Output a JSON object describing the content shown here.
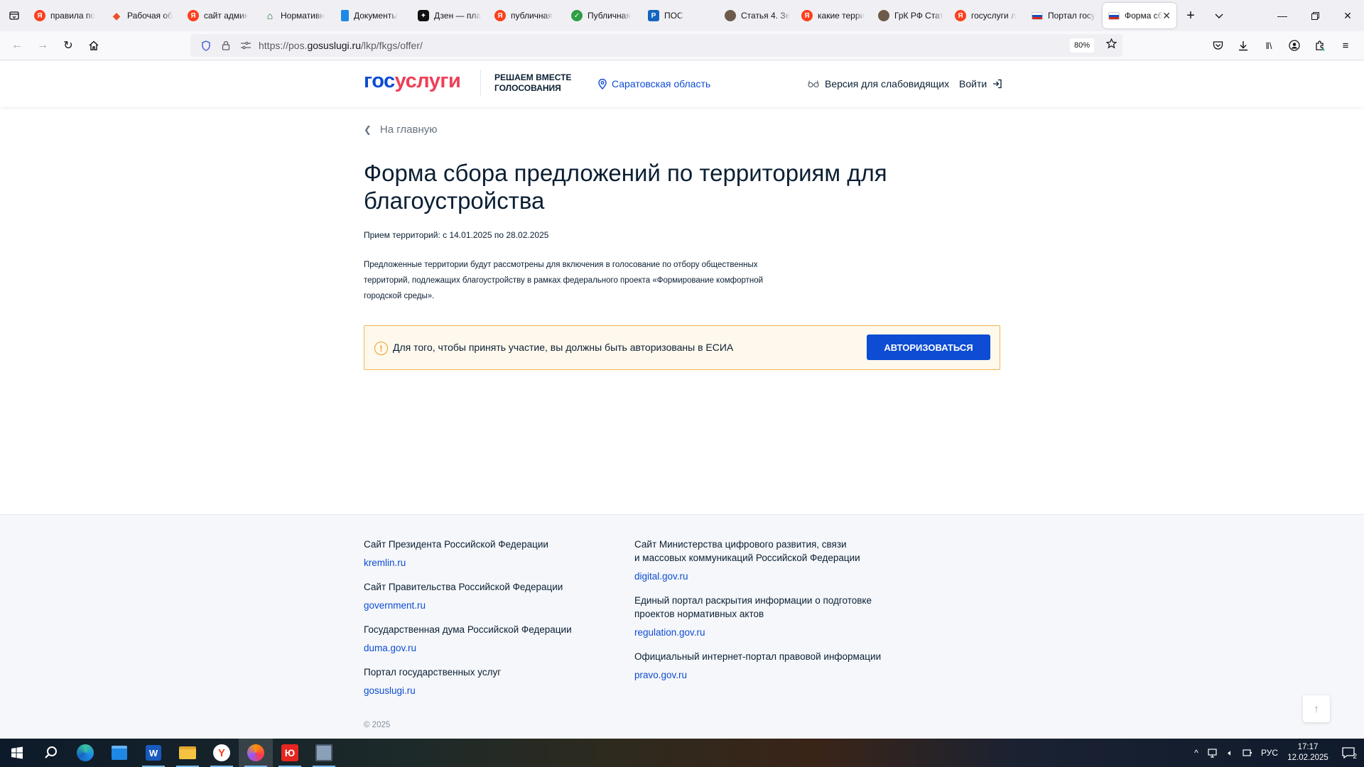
{
  "browser": {
    "tabs": [
      {
        "label": "правила по",
        "icon": "yandex-icon",
        "color": "#fc3f1d"
      },
      {
        "label": "Рабочая об",
        "icon": "workspace-icon",
        "color": "#e8512a"
      },
      {
        "label": "сайт админ",
        "icon": "yandex-icon",
        "color": "#fc3f1d"
      },
      {
        "label": "Нормативн",
        "icon": "government-building-icon",
        "color": "#1b5e20"
      },
      {
        "label": "Документы",
        "icon": "document-icon",
        "color": "#1e88e5"
      },
      {
        "label": "Дзен — пла",
        "icon": "dzen-icon",
        "color": "#111111"
      },
      {
        "label": "публичная",
        "icon": "yandex-icon",
        "color": "#fc3f1d"
      },
      {
        "label": "Публичная",
        "icon": "check-circle-icon",
        "color": "#2e9e44"
      },
      {
        "label": "ПОС",
        "icon": "pos-icon",
        "color": "#1565c0"
      },
      {
        "label": "Статья 4. Зе",
        "icon": "avatar-icon",
        "color": "#6d5a4a"
      },
      {
        "label": "какие терри",
        "icon": "yandex-icon",
        "color": "#fc3f1d"
      },
      {
        "label": "ГрК РФ Стат",
        "icon": "avatar-icon",
        "color": "#6d5a4a"
      },
      {
        "label": "госуслуги л",
        "icon": "yandex-icon",
        "color": "#fc3f1d"
      },
      {
        "label": "Портал госу",
        "icon": "russia-flag-icon",
        "color": "#1a4fc4"
      },
      {
        "label": "Форма сб",
        "icon": "russia-flag-icon",
        "color": "#1a4fc4",
        "active": true
      }
    ],
    "url_prefix": "https://pos.",
    "url_domain": "gosuslugi.ru",
    "url_path": "/lkp/fkgs/offer/",
    "zoom": "80%"
  },
  "header": {
    "logo_part1": "гос",
    "logo_part2": "услуги",
    "slogan_line1": "Решаем вместе",
    "slogan_line2": "голосования",
    "region": "Саратовская область",
    "vision_version": "Версия для слабовидящих",
    "login": "Войти"
  },
  "main": {
    "back_link": "На главную",
    "title": "Форма сбора предложений по территориям для благоустройства",
    "dates": "Прием территорий: с 14.01.2025 по 28.02.2025",
    "description": "Предложенные территории будут рассмотрены для включения в голосование по отбору общественных территорий, подлежащих благоустройству в рамках федерального проекта «Формирование комфортной городской среды».",
    "alert_text": "Для того, чтобы принять участие, вы должны быть авторизованы в ЕСИА",
    "alert_button": "Авторизоваться",
    "accent_color": "#0d4cd3",
    "alert_border_color": "#f2b74a"
  },
  "footer": {
    "left": [
      {
        "title": "Сайт Президента Российской Федерации",
        "link": "kremlin.ru"
      },
      {
        "title": "Сайт Правительства Российской Федерации",
        "link": "government.ru"
      },
      {
        "title": "Государственная дума Российской Федерации",
        "link": "duma.gov.ru"
      },
      {
        "title": "Портал государственных услуг",
        "link": "gosuslugi.ru"
      }
    ],
    "right": [
      {
        "title_line1": "Сайт Министерства цифрового развития, связи",
        "title_line2": "и массовых коммуникаций Российской Федерации",
        "link": "digital.gov.ru"
      },
      {
        "title_line1": "Единый портал раскрытия информации о подготовке",
        "title_line2": "проектов нормативных актов",
        "link": "regulation.gov.ru"
      },
      {
        "title_line1": "Официальный интернет-портал правовой информации",
        "title_line2": "",
        "link": "pravo.gov.ru"
      }
    ],
    "copyright": "© 2025"
  },
  "taskbar": {
    "apps": [
      "start-icon",
      "search-icon",
      "edge-icon",
      "store-icon",
      "word-icon",
      "explorer-icon",
      "yandex-browser-icon",
      "firefox-icon",
      "yandex-music-icon",
      "user-app-icon"
    ],
    "language": "РУС",
    "time": "17:17",
    "date": "12.02.2025",
    "notifications": "2"
  }
}
